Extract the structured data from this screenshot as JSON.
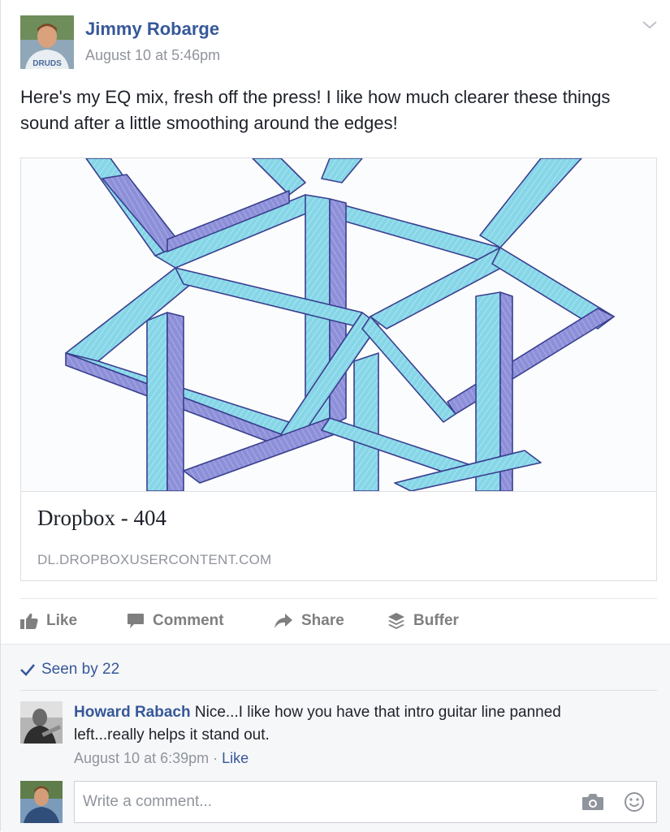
{
  "post": {
    "author": "Jimmy Robarge",
    "timestamp": "August 10 at 5:46pm",
    "text": "Here's my EQ mix, fresh off the press! I like how much clearer these things sound after a little smoothing around the edges!",
    "avatar_shirt_text": "DRUDS"
  },
  "link_preview": {
    "title": "Dropbox - 404",
    "domain": "DL.DROPBOXUSERCONTENT.COM"
  },
  "actions": {
    "like": "Like",
    "comment": "Comment",
    "share": "Share",
    "buffer": "Buffer"
  },
  "seen": {
    "label": "Seen by 22"
  },
  "comments": [
    {
      "author": "Howard Rabach",
      "text": "Nice...I like how you have that intro guitar line panned left...really helps it stand out.",
      "timestamp": "August 10 at 6:39pm",
      "separator": "·",
      "like_label": "Like"
    }
  ],
  "composer": {
    "placeholder": "Write a comment..."
  },
  "colors": {
    "link_blue": "#365899",
    "meta_gray": "#90949c",
    "action_gray": "#7f7f7f",
    "drawing_cyan": "#7fd6e6",
    "drawing_blue": "#8a8fd6"
  },
  "icons": [
    "chevron-down-icon",
    "like-thumb-icon",
    "comment-bubble-icon",
    "share-arrow-icon",
    "buffer-stack-icon",
    "checkmark-icon",
    "camera-icon",
    "emoji-icon"
  ]
}
